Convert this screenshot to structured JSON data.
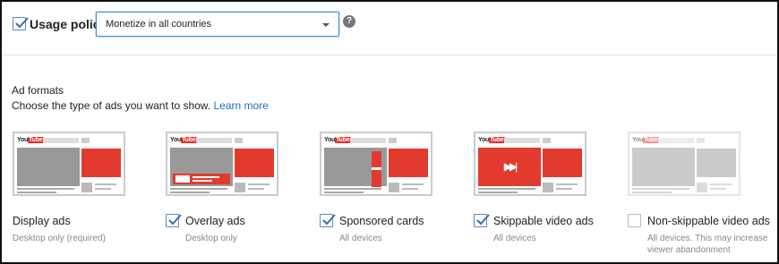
{
  "policy": {
    "label": "Usage policy",
    "checked": true,
    "select_value": "Monetize in all countries",
    "help_icon": "question-mark-icon"
  },
  "ad_formats": {
    "title": "Ad formats",
    "description": "Choose the type of ads you want to show.",
    "link": "Learn more"
  },
  "cards": [
    {
      "label": "Display ads",
      "sub": "Desktop only (required)",
      "checkable": false,
      "checked": false,
      "logo": "YouTube"
    },
    {
      "label": "Overlay ads",
      "sub": "Desktop only",
      "checkable": true,
      "checked": true,
      "logo": "YouTube"
    },
    {
      "label": "Sponsored cards",
      "sub": "All devices",
      "checkable": true,
      "checked": true,
      "logo": "YouTube"
    },
    {
      "label": "Skippable video ads",
      "sub": "All devices",
      "checkable": true,
      "checked": true,
      "logo": "YouTube",
      "icon": "skip-forward-icon"
    },
    {
      "label": "Non-skippable video ads",
      "sub": "All devices. This may increase viewer abandonment",
      "checkable": true,
      "checked": false,
      "logo": "YouTube"
    }
  ],
  "colors": {
    "accent": "#e33a2f",
    "link": "#1a6fc2",
    "checkbox": "#5d8bbd"
  }
}
